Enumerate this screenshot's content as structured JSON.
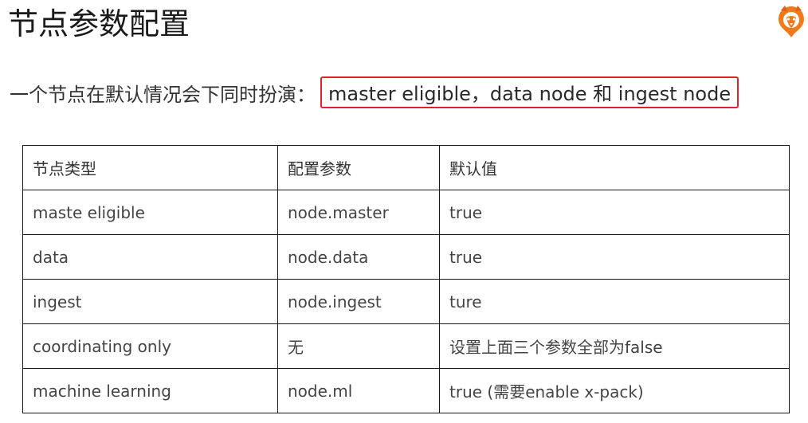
{
  "title": "节点参数配置",
  "intro": {
    "lead": "一个节点在默认情况会下同时扮演：",
    "highlight": "master eligible，data node 和 ingest node",
    "highlight_border_color": "#e0232b"
  },
  "logo": {
    "icon": "tiger-logo-icon",
    "color": "#f07a1a"
  },
  "table": {
    "headers": [
      "节点类型",
      "配置参数",
      "默认值"
    ],
    "rows": [
      [
        "maste eligible",
        "node.master",
        "true"
      ],
      [
        "data",
        "node.data",
        "true"
      ],
      [
        "ingest",
        "node.ingest",
        "ture"
      ],
      [
        "coordinating only",
        "无",
        "设置上面三个参数全部为false"
      ],
      [
        "machine learning",
        "node.ml",
        "true (需要enable x-pack)"
      ]
    ]
  }
}
